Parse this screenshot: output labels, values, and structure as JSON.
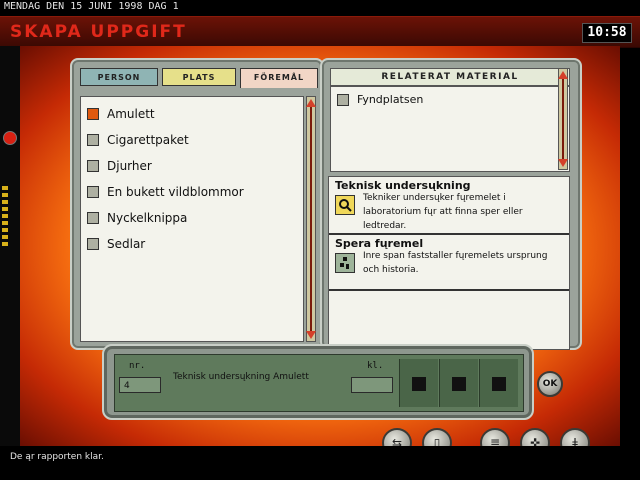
{
  "header": {
    "date_line": "MENDAG DEN 15 JUNI 1998 DAG 1",
    "title": "SKAPA UPPGIFT",
    "clock": "10:58"
  },
  "tabs": [
    {
      "label": "PERSON",
      "color": "#8fb4b4"
    },
    {
      "label": "PLATS",
      "color": "#e6e08a"
    },
    {
      "label": "FÖREMÅL",
      "color": "#f2d6c6",
      "active": true
    }
  ],
  "objects": [
    {
      "label": "Amulett",
      "checked": true
    },
    {
      "label": "Cigarettpaket",
      "checked": false
    },
    {
      "label": "Djurher",
      "checked": false
    },
    {
      "label": "En bukett vildblommor",
      "checked": false
    },
    {
      "label": "Nyckelknippa",
      "checked": false
    },
    {
      "label": "Sedlar",
      "checked": false
    }
  ],
  "related": {
    "heading": "RELATERAT MATERIAL",
    "items": [
      {
        "label": "Fyndplatsen"
      }
    ]
  },
  "methods": [
    {
      "title": "Teknisk undersųkning",
      "icon": "magnifier-icon",
      "desc1": "Tekniker undersųker fųremelet i",
      "desc2": "laboratorium fųr att finna sper eller",
      "desc3": "ledtredar."
    },
    {
      "title": "Spera fųremel",
      "icon": "trace-icon",
      "desc1": "Inre span faststaller fųremelets ursprung",
      "desc2": "och historia."
    }
  ],
  "task": {
    "nr_label": "nr.",
    "nr_value": "4",
    "description": "Teknisk undersųkning Amulett",
    "kl_label": "kl.",
    "kl_value": ""
  },
  "ok_label": "OK",
  "status": "De ąr rapporten klar.",
  "colors": {
    "accent": "#e0281a",
    "checked": "#e05a10"
  }
}
